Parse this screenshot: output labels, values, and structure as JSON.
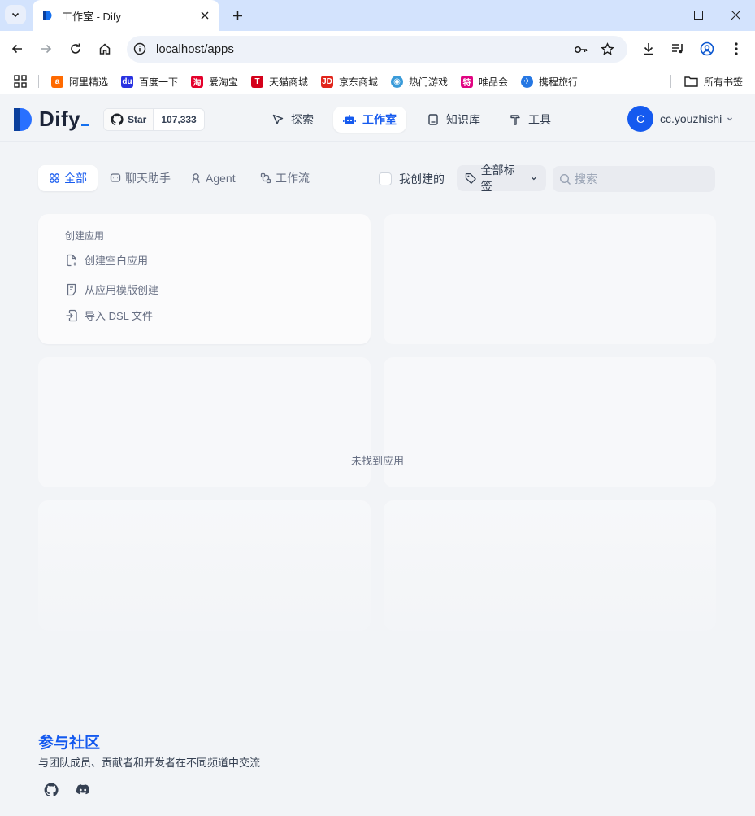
{
  "browser": {
    "tab_title": "工作室 - Dify",
    "url": "localhost/apps",
    "bookmarks": [
      "阿里精选",
      "百度一下",
      "爱淘宝",
      "天猫商城",
      "京东商城",
      "热门游戏",
      "唯品会",
      "携程旅行"
    ],
    "bookmark_folder": "所有书签"
  },
  "header": {
    "logo_text": "Dify",
    "github_star_label": "Star",
    "github_star_count": "107,333",
    "nav": [
      "探索",
      "工作室",
      "知识库",
      "工具"
    ],
    "active_nav": "工作室",
    "user_initial": "C",
    "user_name": "cc.youzhishi"
  },
  "filters": {
    "tabs": [
      "全部",
      "聊天助手",
      "Agent",
      "工作流"
    ],
    "active_tab": "全部",
    "mine_label": "我创建的",
    "tags_label": "全部标签",
    "search_placeholder": "搜索"
  },
  "create_card": {
    "title": "创建应用",
    "items": [
      "创建空白应用",
      "从应用模版创建",
      "导入 DSL 文件"
    ]
  },
  "empty_text": "未找到应用",
  "footer": {
    "title": "参与社区",
    "desc": "与团队成员、贡献者和开发者在不同频道中交流"
  },
  "colors": {
    "accent": "#155aef",
    "background": "#f2f4f7"
  }
}
